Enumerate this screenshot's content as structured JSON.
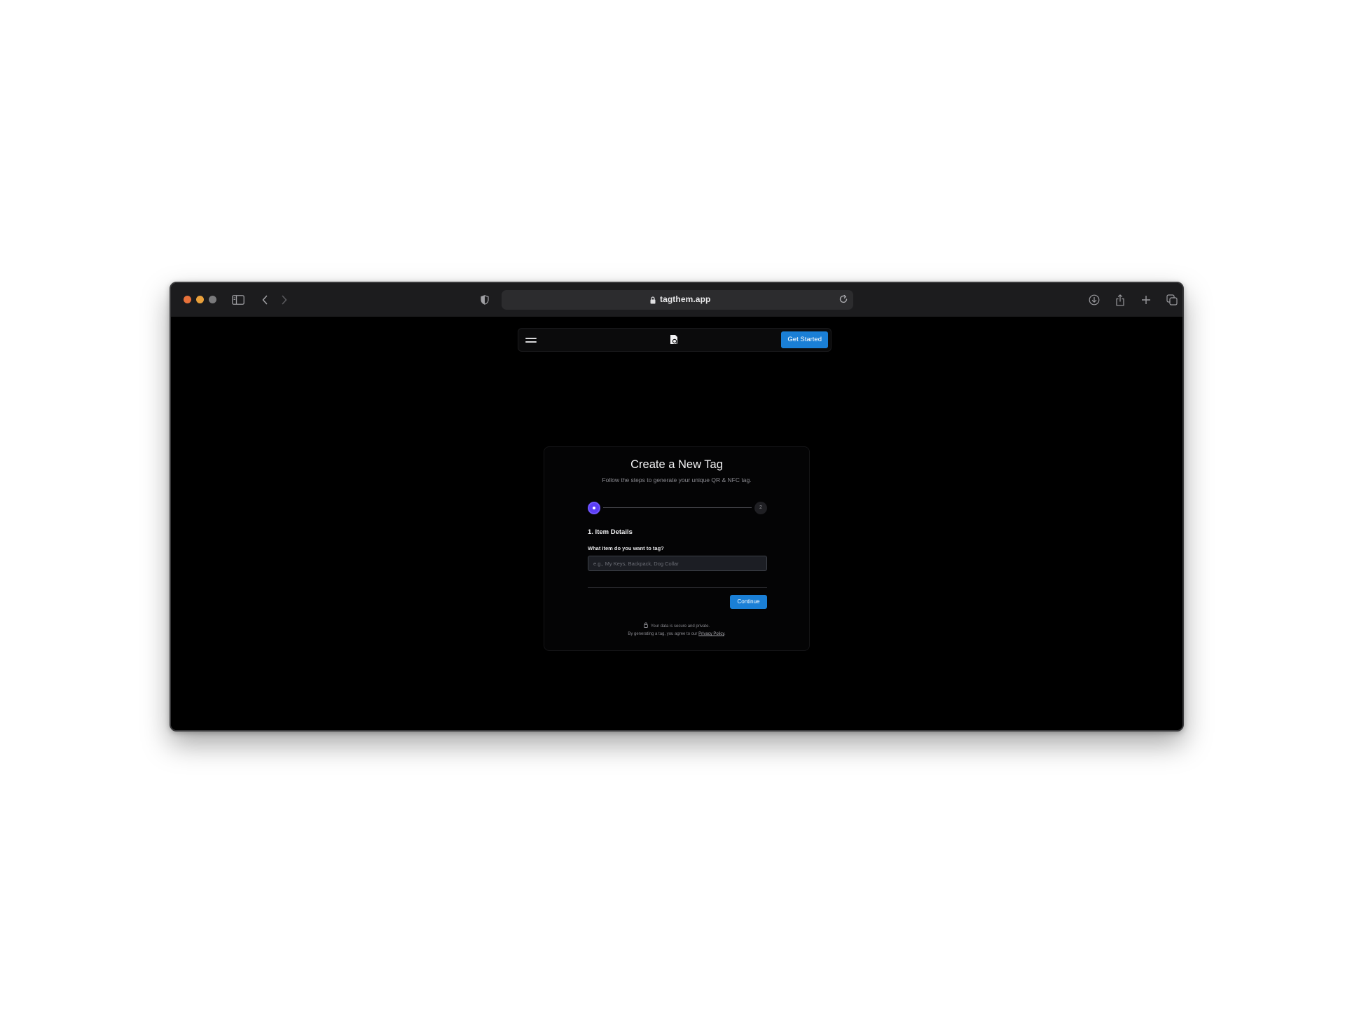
{
  "browser": {
    "url": "tagthem.app",
    "icons": {
      "sidebar": "sidebar-icon",
      "back": "chevron-left-icon",
      "forward": "chevron-right-icon",
      "shield": "shield-icon",
      "lock": "lock-icon",
      "reload": "reload-icon",
      "download": "download-icon",
      "share": "share-icon",
      "new_tab": "plus-icon",
      "tabs": "tabs-overview-icon"
    }
  },
  "navbar": {
    "menu_icon": "hamburger-icon",
    "logo_icon": "tagthem-logo-icon",
    "cta_label": "Get Started"
  },
  "card": {
    "title": "Create a New Tag",
    "subtitle": "Follow the steps to generate your unique QR & NFC tag.",
    "steps": {
      "current": 1,
      "total": 2,
      "step2_label": "2"
    },
    "section_title": "1. Item Details",
    "field_label": "What item do you want to tag?",
    "field_placeholder": "e.g., My Keys, Backpack, Dog Collar",
    "field_value": "",
    "continue_label": "Continue",
    "secure_text": "Your data is secure and private.",
    "privacy_prefix": "By generating a tag, you agree to our",
    "privacy_link": "Privacy Policy",
    "privacy_suffix": "."
  },
  "colors": {
    "accent": "#1a7fd6",
    "step_active": "#5b3df5",
    "page_bg": "#000000",
    "toolbar_bg": "#1c1c1e"
  }
}
